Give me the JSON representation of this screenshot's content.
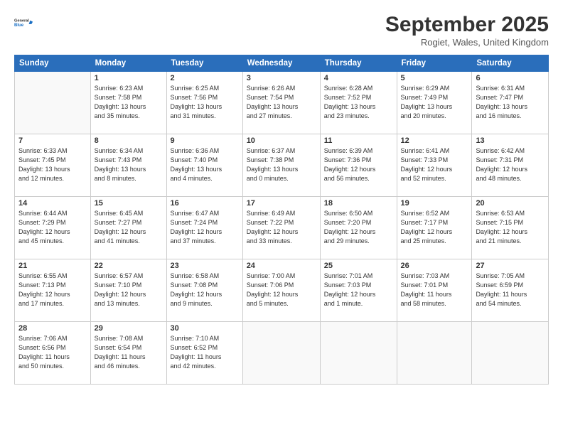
{
  "header": {
    "logo_line1": "General",
    "logo_line2": "Blue",
    "month": "September 2025",
    "location": "Rogiet, Wales, United Kingdom"
  },
  "weekdays": [
    "Sunday",
    "Monday",
    "Tuesday",
    "Wednesday",
    "Thursday",
    "Friday",
    "Saturday"
  ],
  "weeks": [
    [
      {
        "day": "",
        "info": ""
      },
      {
        "day": "1",
        "info": "Sunrise: 6:23 AM\nSunset: 7:58 PM\nDaylight: 13 hours\nand 35 minutes."
      },
      {
        "day": "2",
        "info": "Sunrise: 6:25 AM\nSunset: 7:56 PM\nDaylight: 13 hours\nand 31 minutes."
      },
      {
        "day": "3",
        "info": "Sunrise: 6:26 AM\nSunset: 7:54 PM\nDaylight: 13 hours\nand 27 minutes."
      },
      {
        "day": "4",
        "info": "Sunrise: 6:28 AM\nSunset: 7:52 PM\nDaylight: 13 hours\nand 23 minutes."
      },
      {
        "day": "5",
        "info": "Sunrise: 6:29 AM\nSunset: 7:49 PM\nDaylight: 13 hours\nand 20 minutes."
      },
      {
        "day": "6",
        "info": "Sunrise: 6:31 AM\nSunset: 7:47 PM\nDaylight: 13 hours\nand 16 minutes."
      }
    ],
    [
      {
        "day": "7",
        "info": "Sunrise: 6:33 AM\nSunset: 7:45 PM\nDaylight: 13 hours\nand 12 minutes."
      },
      {
        "day": "8",
        "info": "Sunrise: 6:34 AM\nSunset: 7:43 PM\nDaylight: 13 hours\nand 8 minutes."
      },
      {
        "day": "9",
        "info": "Sunrise: 6:36 AM\nSunset: 7:40 PM\nDaylight: 13 hours\nand 4 minutes."
      },
      {
        "day": "10",
        "info": "Sunrise: 6:37 AM\nSunset: 7:38 PM\nDaylight: 13 hours\nand 0 minutes."
      },
      {
        "day": "11",
        "info": "Sunrise: 6:39 AM\nSunset: 7:36 PM\nDaylight: 12 hours\nand 56 minutes."
      },
      {
        "day": "12",
        "info": "Sunrise: 6:41 AM\nSunset: 7:33 PM\nDaylight: 12 hours\nand 52 minutes."
      },
      {
        "day": "13",
        "info": "Sunrise: 6:42 AM\nSunset: 7:31 PM\nDaylight: 12 hours\nand 48 minutes."
      }
    ],
    [
      {
        "day": "14",
        "info": "Sunrise: 6:44 AM\nSunset: 7:29 PM\nDaylight: 12 hours\nand 45 minutes."
      },
      {
        "day": "15",
        "info": "Sunrise: 6:45 AM\nSunset: 7:27 PM\nDaylight: 12 hours\nand 41 minutes."
      },
      {
        "day": "16",
        "info": "Sunrise: 6:47 AM\nSunset: 7:24 PM\nDaylight: 12 hours\nand 37 minutes."
      },
      {
        "day": "17",
        "info": "Sunrise: 6:49 AM\nSunset: 7:22 PM\nDaylight: 12 hours\nand 33 minutes."
      },
      {
        "day": "18",
        "info": "Sunrise: 6:50 AM\nSunset: 7:20 PM\nDaylight: 12 hours\nand 29 minutes."
      },
      {
        "day": "19",
        "info": "Sunrise: 6:52 AM\nSunset: 7:17 PM\nDaylight: 12 hours\nand 25 minutes."
      },
      {
        "day": "20",
        "info": "Sunrise: 6:53 AM\nSunset: 7:15 PM\nDaylight: 12 hours\nand 21 minutes."
      }
    ],
    [
      {
        "day": "21",
        "info": "Sunrise: 6:55 AM\nSunset: 7:13 PM\nDaylight: 12 hours\nand 17 minutes."
      },
      {
        "day": "22",
        "info": "Sunrise: 6:57 AM\nSunset: 7:10 PM\nDaylight: 12 hours\nand 13 minutes."
      },
      {
        "day": "23",
        "info": "Sunrise: 6:58 AM\nSunset: 7:08 PM\nDaylight: 12 hours\nand 9 minutes."
      },
      {
        "day": "24",
        "info": "Sunrise: 7:00 AM\nSunset: 7:06 PM\nDaylight: 12 hours\nand 5 minutes."
      },
      {
        "day": "25",
        "info": "Sunrise: 7:01 AM\nSunset: 7:03 PM\nDaylight: 12 hours\nand 1 minute."
      },
      {
        "day": "26",
        "info": "Sunrise: 7:03 AM\nSunset: 7:01 PM\nDaylight: 11 hours\nand 58 minutes."
      },
      {
        "day": "27",
        "info": "Sunrise: 7:05 AM\nSunset: 6:59 PM\nDaylight: 11 hours\nand 54 minutes."
      }
    ],
    [
      {
        "day": "28",
        "info": "Sunrise: 7:06 AM\nSunset: 6:56 PM\nDaylight: 11 hours\nand 50 minutes."
      },
      {
        "day": "29",
        "info": "Sunrise: 7:08 AM\nSunset: 6:54 PM\nDaylight: 11 hours\nand 46 minutes."
      },
      {
        "day": "30",
        "info": "Sunrise: 7:10 AM\nSunset: 6:52 PM\nDaylight: 11 hours\nand 42 minutes."
      },
      {
        "day": "",
        "info": ""
      },
      {
        "day": "",
        "info": ""
      },
      {
        "day": "",
        "info": ""
      },
      {
        "day": "",
        "info": ""
      }
    ]
  ]
}
